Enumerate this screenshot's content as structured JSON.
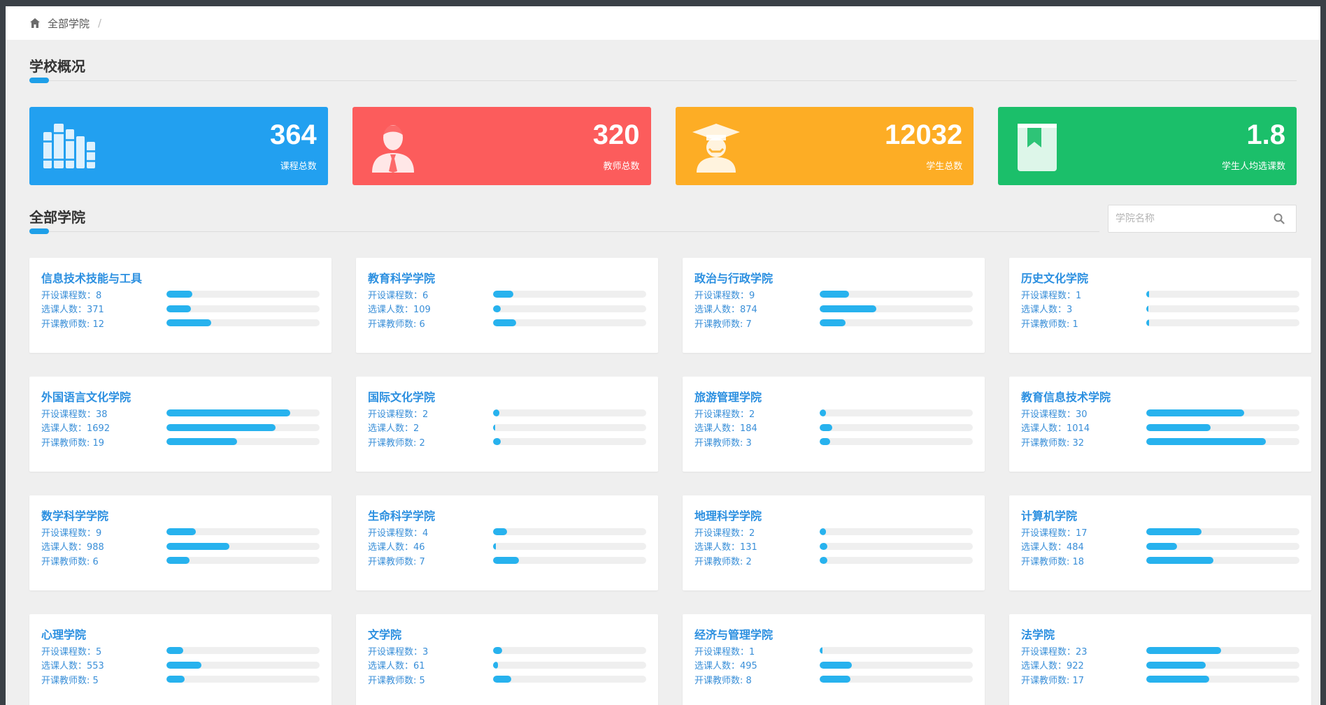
{
  "breadcrumb": {
    "home_label": "全部学院",
    "separator": "/"
  },
  "overview": {
    "title": "学校概况"
  },
  "stats": [
    {
      "value": "364",
      "label": "课程总数",
      "color": "#22a0f0",
      "icon": "books-icon"
    },
    {
      "value": "320",
      "label": "教师总数",
      "color": "#fc5c5c",
      "icon": "teacher-icon"
    },
    {
      "value": "12032",
      "label": "学生总数",
      "color": "#fdad25",
      "icon": "graduate-icon"
    },
    {
      "value": "1.8",
      "label": "学生人均选课数",
      "color": "#1bbf6a",
      "icon": "bookmark-book-icon"
    }
  ],
  "colleges_section": {
    "title": "全部学院",
    "search_placeholder": "学院名称"
  },
  "colleges": [
    {
      "name": "信息技术技能与工具",
      "courses": "开设课程数：8",
      "students": "选课人数：371",
      "teachers": "开课教师数: 12",
      "course_frac": 0.17,
      "student_frac": 0.16,
      "teacher_frac": 0.29
    },
    {
      "name": "教育科学学院",
      "courses": "开设课程数：6",
      "students": "选课人数：109",
      "teachers": "开课教师数: 6",
      "course_frac": 0.13,
      "student_frac": 0.05,
      "teacher_frac": 0.15
    },
    {
      "name": "政治与行政学院",
      "courses": "开设课程数：9",
      "students": "选课人数：874",
      "teachers": "开课教师数: 7",
      "course_frac": 0.19,
      "student_frac": 0.37,
      "teacher_frac": 0.17
    },
    {
      "name": "历史文化学院",
      "courses": "开设课程数：1",
      "students": "选课人数：3",
      "teachers": "开课教师数: 1",
      "course_frac": 0.02,
      "student_frac": 0.0,
      "teacher_frac": 0.02
    },
    {
      "name": "外国语言文化学院",
      "courses": "开设课程数：38",
      "students": "选课人数：1692",
      "teachers": "开课教师数: 19",
      "course_frac": 0.81,
      "student_frac": 0.71,
      "teacher_frac": 0.46
    },
    {
      "name": "国际文化学院",
      "courses": "开设课程数：2",
      "students": "选课人数：2",
      "teachers": "开课教师数: 2",
      "course_frac": 0.04,
      "student_frac": 0.0,
      "teacher_frac": 0.05
    },
    {
      "name": "旅游管理学院",
      "courses": "开设课程数：2",
      "students": "选课人数：184",
      "teachers": "开课教师数: 3",
      "course_frac": 0.04,
      "student_frac": 0.08,
      "teacher_frac": 0.07
    },
    {
      "name": "教育信息技术学院",
      "courses": "开设课程数：30",
      "students": "选课人数：1014",
      "teachers": "开课教师数: 32",
      "course_frac": 0.64,
      "student_frac": 0.42,
      "teacher_frac": 0.78
    },
    {
      "name": "数学科学学院",
      "courses": "开设课程数：9",
      "students": "选课人数：988",
      "teachers": "开课教师数: 6",
      "course_frac": 0.19,
      "student_frac": 0.41,
      "teacher_frac": 0.15
    },
    {
      "name": "生命科学学院",
      "courses": "开设课程数：4",
      "students": "选课人数：46",
      "teachers": "开课教师数: 7",
      "course_frac": 0.09,
      "student_frac": 0.02,
      "teacher_frac": 0.17
    },
    {
      "name": "地理科学学院",
      "courses": "开设课程数：2",
      "students": "选课人数：131",
      "teachers": "开课教师数: 2",
      "course_frac": 0.04,
      "student_frac": 0.05,
      "teacher_frac": 0.05
    },
    {
      "name": "计算机学院",
      "courses": "开设课程数：17",
      "students": "选课人数：484",
      "teachers": "开课教师数: 18",
      "course_frac": 0.36,
      "student_frac": 0.2,
      "teacher_frac": 0.44
    },
    {
      "name": "心理学院",
      "courses": "开设课程数：5",
      "students": "选课人数：553",
      "teachers": "开课教师数: 5",
      "course_frac": 0.11,
      "student_frac": 0.23,
      "teacher_frac": 0.12
    },
    {
      "name": "文学院",
      "courses": "开设课程数：3",
      "students": "选课人数：61",
      "teachers": "开课教师数: 5",
      "course_frac": 0.06,
      "student_frac": 0.03,
      "teacher_frac": 0.12
    },
    {
      "name": "经济与管理学院",
      "courses": "开设课程数：1",
      "students": "选课人数：495",
      "teachers": "开课教师数: 8",
      "course_frac": 0.02,
      "student_frac": 0.21,
      "teacher_frac": 0.2
    },
    {
      "name": "法学院",
      "courses": "开设课程数：23",
      "students": "选课人数：922",
      "teachers": "开课教师数: 17",
      "course_frac": 0.49,
      "student_frac": 0.39,
      "teacher_frac": 0.41
    }
  ]
}
